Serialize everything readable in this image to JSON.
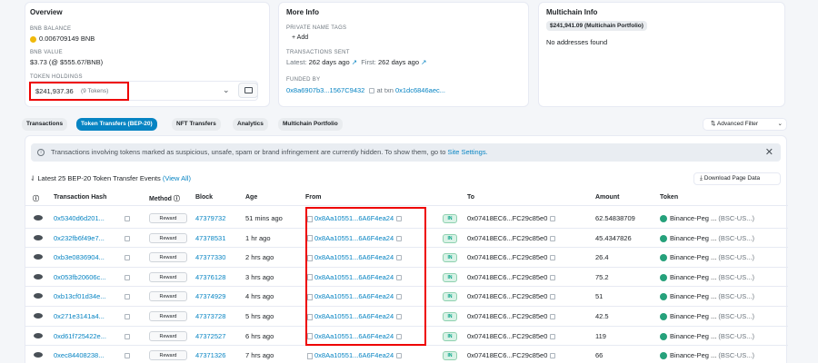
{
  "overview": {
    "title": "Overview",
    "bnb_balance_label": "BNB BALANCE",
    "bnb_balance_value": "0.006709149 BNB",
    "bnb_value_label": "BNB VALUE",
    "bnb_value_value": "$3.73 (@ $555.67/BNB)",
    "token_holdings_label": "TOKEN HOLDINGS",
    "token_holdings_amount": "$241,937.36",
    "token_holdings_count": "(9 Tokens)"
  },
  "more_info": {
    "title": "More Info",
    "private_tags_label": "PRIVATE NAME TAGS",
    "add_label": "+ Add",
    "tx_sent_label": "TRANSACTIONS SENT",
    "latest_prefix": "Latest:",
    "latest_value": "262 days ago",
    "first_prefix": "First:",
    "first_value": "262 days ago",
    "funded_label": "FUNDED BY",
    "funded_addr": "0x8a6907b3...1567C9432",
    "funded_at": "at txn",
    "funded_txn": "0x1dc6846aec..."
  },
  "multichain": {
    "title": "Multichain Info",
    "badge": "$241,941.09 (Multichain Portfolio)",
    "note": "No addresses found"
  },
  "tabs": [
    {
      "label": "Transactions"
    },
    {
      "label": "Token Transfers (BEP-20)"
    },
    {
      "label": "NFT Transfers"
    },
    {
      "label": "Analytics"
    },
    {
      "label": "Multichain Portfolio"
    }
  ],
  "advanced_filter": "Advanced Filter",
  "notice": {
    "text": "Transactions involving tokens marked as suspicious, unsafe, spam or brand infringement are currently hidden. To show them, go to",
    "link": "Site Settings."
  },
  "summary": {
    "prefix": "Latest 25 BEP-20 Token Transfer Events",
    "link": "(View All)"
  },
  "download": "Download Page Data",
  "columns": {
    "hash": "Transaction Hash",
    "method": "Method",
    "block": "Block",
    "age": "Age",
    "from": "From",
    "to": "To",
    "amount": "Amount",
    "token": "Token"
  },
  "rows": [
    {
      "hash": "0x5340d6d201...",
      "method": "Reward",
      "block": "47379732",
      "age": "51 mins ago",
      "from": "0x8Aa10551...6A6F4ea24",
      "dir": "IN",
      "to": "0x07418EC6...FC29c85e0",
      "amount": "62.54838709",
      "token": "Binance-Peg ...",
      "token_sym": "(BSC-US...)"
    },
    {
      "hash": "0x232fb6f49e7...",
      "method": "Reward",
      "block": "47378531",
      "age": "1 hr ago",
      "from": "0x8Aa10551...6A6F4ea24",
      "dir": "IN",
      "to": "0x07418EC6...FC29c85e0",
      "amount": "45.4347826",
      "token": "Binance-Peg ...",
      "token_sym": "(BSC-US...)"
    },
    {
      "hash": "0xb3e0836904...",
      "method": "Reward",
      "block": "47377330",
      "age": "2 hrs ago",
      "from": "0x8Aa10551...6A6F4ea24",
      "dir": "IN",
      "to": "0x07418EC6...FC29c85e0",
      "amount": "26.4",
      "token": "Binance-Peg ...",
      "token_sym": "(BSC-US...)"
    },
    {
      "hash": "0x053fb20606c...",
      "method": "Reward",
      "block": "47376128",
      "age": "3 hrs ago",
      "from": "0x8Aa10551...6A6F4ea24",
      "dir": "IN",
      "to": "0x07418EC6...FC29c85e0",
      "amount": "75.2",
      "token": "Binance-Peg ...",
      "token_sym": "(BSC-US...)"
    },
    {
      "hash": "0xb13cf01d34e...",
      "method": "Reward",
      "block": "47374929",
      "age": "4 hrs ago",
      "from": "0x8Aa10551...6A6F4ea24",
      "dir": "IN",
      "to": "0x07418EC6...FC29c85e0",
      "amount": "51",
      "token": "Binance-Peg ...",
      "token_sym": "(BSC-US...)"
    },
    {
      "hash": "0x271e3141a4...",
      "method": "Reward",
      "block": "47373728",
      "age": "5 hrs ago",
      "from": "0x8Aa10551...6A6F4ea24",
      "dir": "IN",
      "to": "0x07418EC6...FC29c85e0",
      "amount": "42.5",
      "token": "Binance-Peg ...",
      "token_sym": "(BSC-US...)"
    },
    {
      "hash": "0xd61f725422e...",
      "method": "Reward",
      "block": "47372527",
      "age": "6 hrs ago",
      "from": "0x8Aa10551...6A6F4ea24",
      "dir": "IN",
      "to": "0x07418EC6...FC29c85e0",
      "amount": "119",
      "token": "Binance-Peg ...",
      "token_sym": "(BSC-US...)"
    },
    {
      "hash": "0xec84408238...",
      "method": "Reward",
      "block": "47371326",
      "age": "7 hrs ago",
      "from": "0x8Aa10551...6A6F4ea24",
      "dir": "IN",
      "to": "0x07418EC6...FC29c85e0",
      "amount": "66",
      "token": "Binance-Peg ...",
      "token_sym": "(BSC-US...)"
    }
  ]
}
